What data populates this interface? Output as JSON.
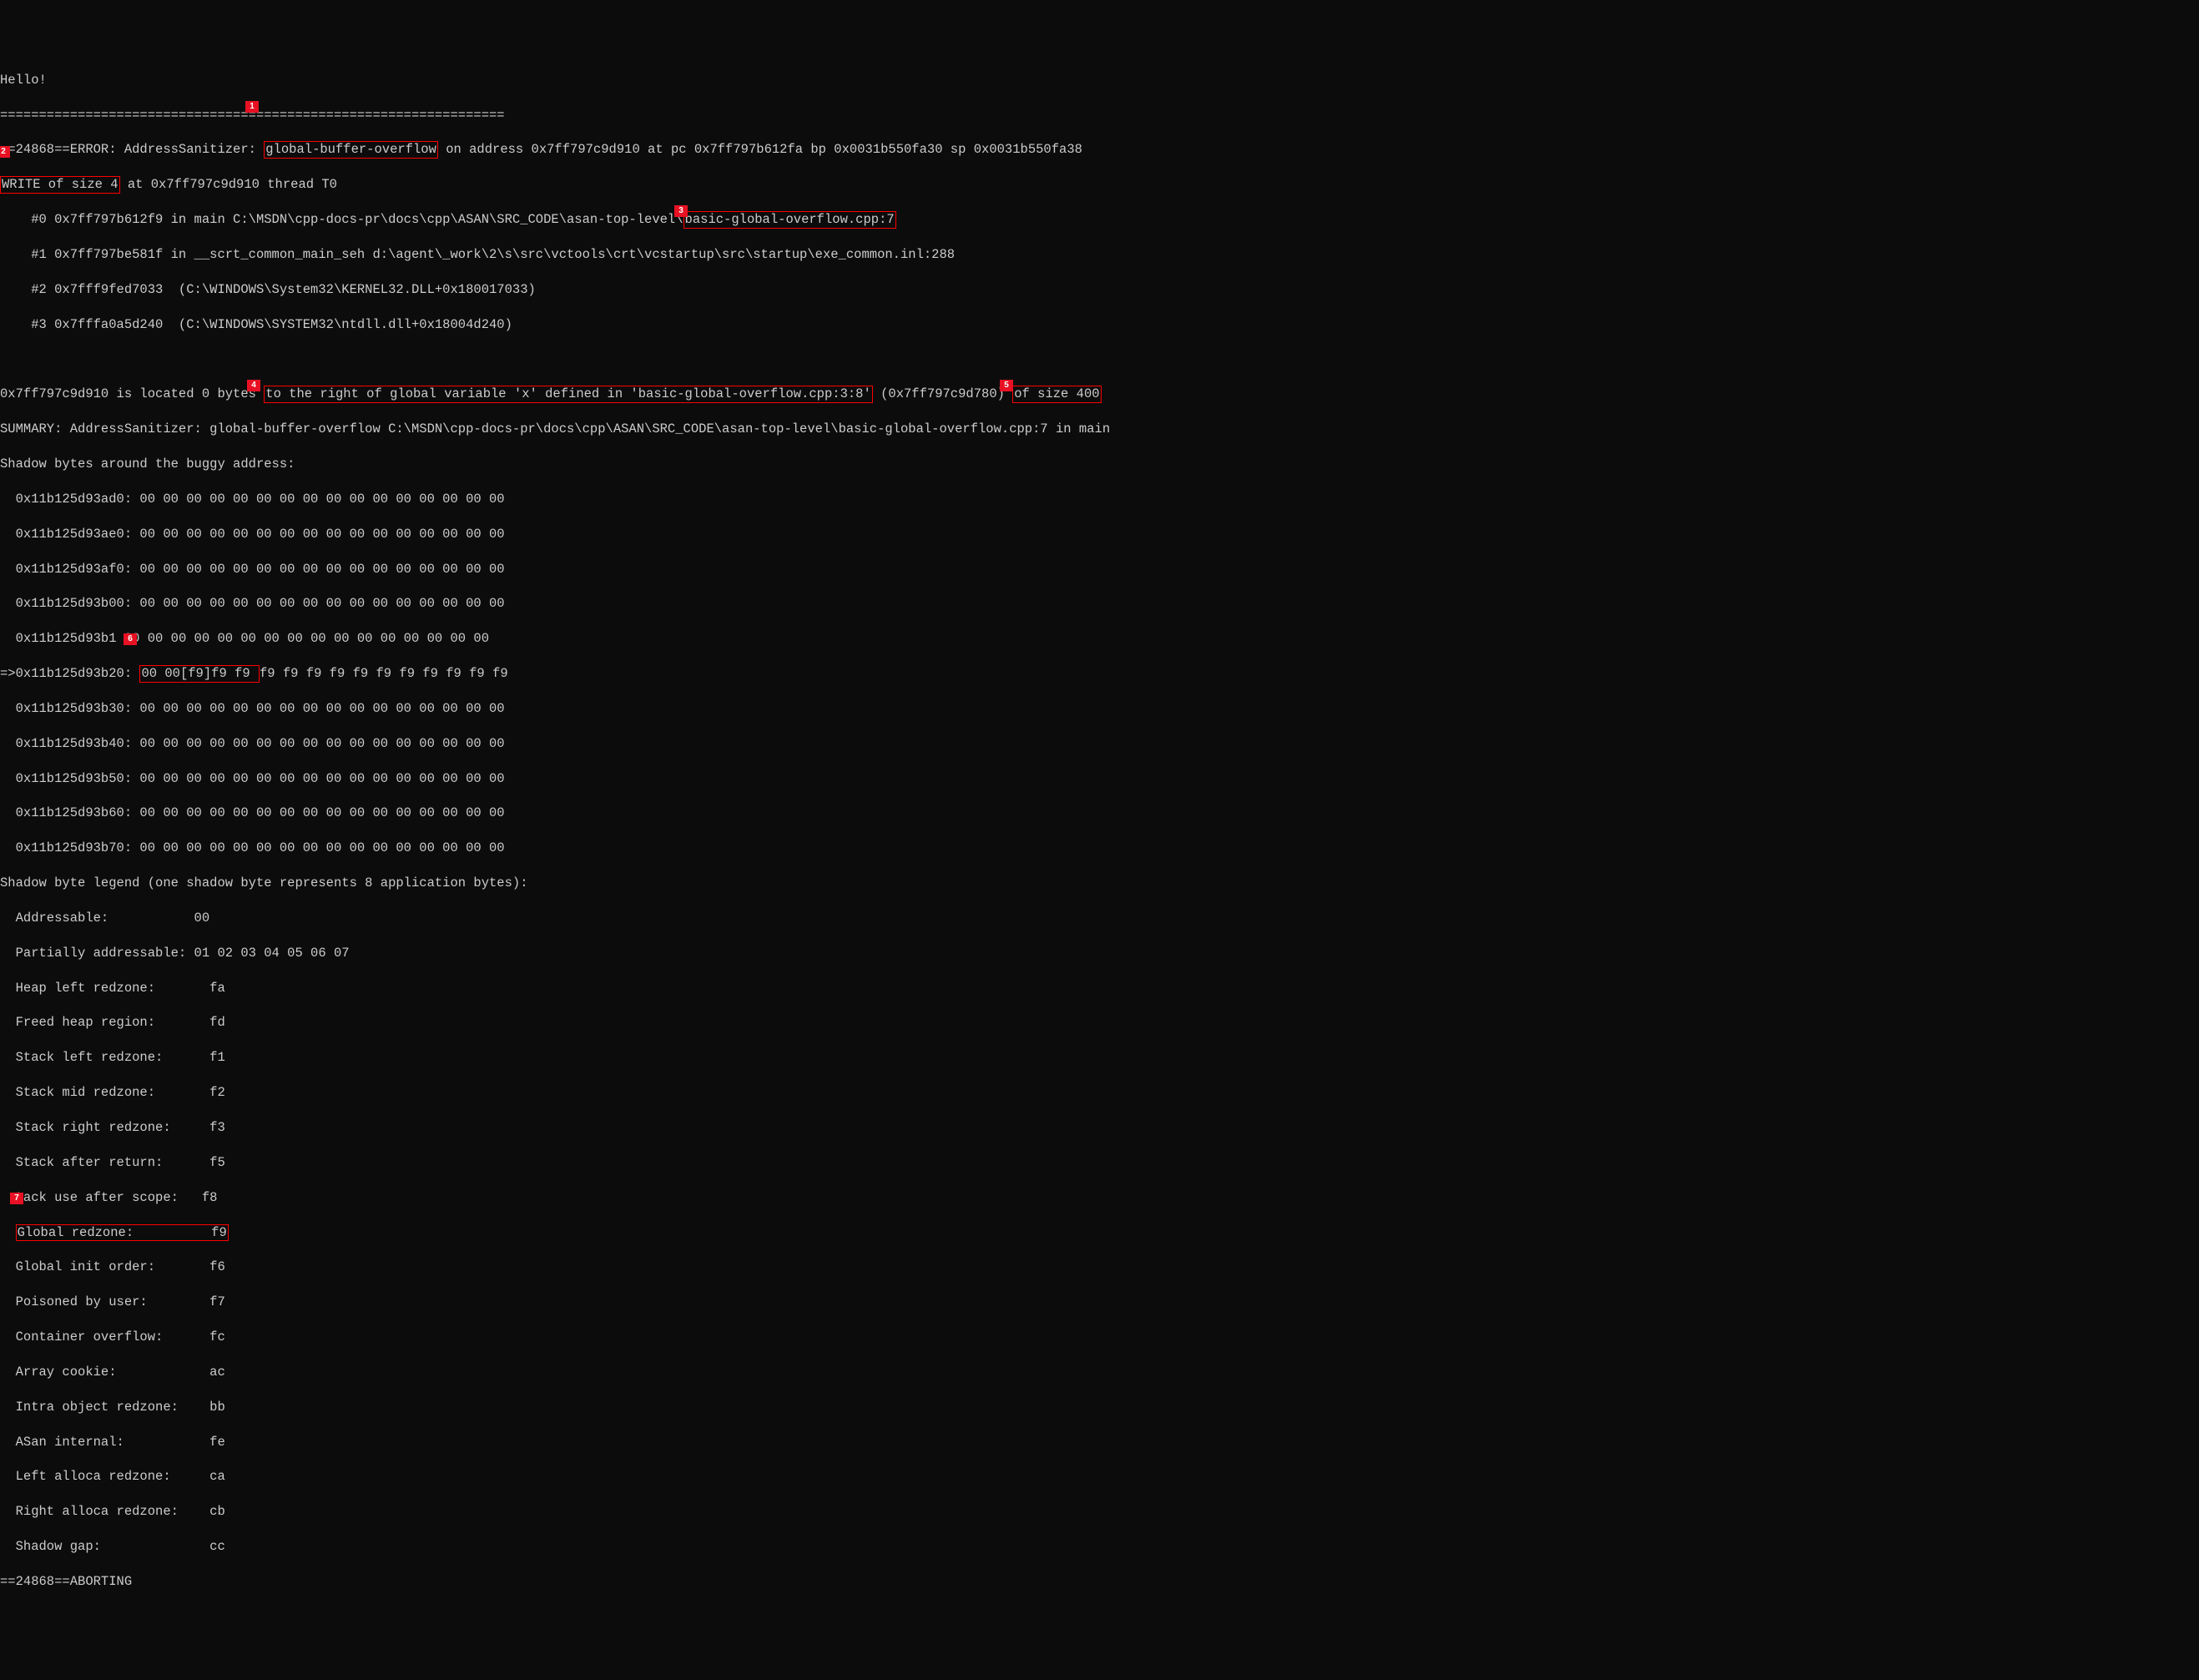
{
  "hello": "Hello!",
  "sep": "=================================================================",
  "err_a": "==24868==ERROR: AddressSanitizer: ",
  "err_type": "global-buffer-overflow",
  "err_b": " on address 0x7ff797c9d910 at pc 0x7ff797b612fa bp 0x0031b550fa30 sp 0x0031b550fa38",
  "write_a": "WRITE of size 4",
  "write_b": " at 0x7ff797c9d910 thread T0",
  "stack": {
    "f0a": "    #0 0x7ff797b612f9 in main C:\\MSDN\\cpp-docs-pr\\docs\\cpp\\ASAN\\SRC_CODE\\asan-top-level\\",
    "f0b": "basic-global-overflow.cpp:7",
    "f1": "    #1 0x7ff797be581f in __scrt_common_main_seh d:\\agent\\_work\\2\\s\\src\\vctools\\crt\\vcstartup\\src\\startup\\exe_common.inl:288",
    "f2": "    #2 0x7fff9fed7033  (C:\\WINDOWS\\System32\\KERNEL32.DLL+0x180017033)",
    "f3": "    #3 0x7fffa0a5d240  (C:\\WINDOWS\\SYSTEM32\\ntdll.dll+0x18004d240)"
  },
  "loc_a": "0x7ff797c9d910 is located 0 bytes ",
  "loc_b": "to the right of global variable 'x' defined in 'basic-global-overflow.cpp:3:8'",
  "loc_c": " (0x7ff797c9d780) ",
  "loc_d": "of size 400",
  "summary": "SUMMARY: AddressSanitizer: global-buffer-overflow C:\\MSDN\\cpp-docs-pr\\docs\\cpp\\ASAN\\SRC_CODE\\asan-top-level\\basic-global-overflow.cpp:7 in main",
  "shadow_hdr": "Shadow bytes around the buggy address:",
  "shadow": {
    "r0": "  0x11b125d93ad0: 00 00 00 00 00 00 00 00 00 00 00 00 00 00 00 00",
    "r1": "  0x11b125d93ae0: 00 00 00 00 00 00 00 00 00 00 00 00 00 00 00 00",
    "r2": "  0x11b125d93af0: 00 00 00 00 00 00 00 00 00 00 00 00 00 00 00 00",
    "r3": "  0x11b125d93b00: 00 00 00 00 00 00 00 00 00 00 00 00 00 00 00 00",
    "r4a": "  0x11b125d93b1",
    "r4b": " 00 00 00 00 00 00 00 00 00 00 00 00 00 00 00 00",
    "r5a": "=>0x11b125d93b20: ",
    "r5b": "00 00[f9]f9 f9 ",
    "r5c": "f9 f9 f9 f9 f9 f9 f9 f9 f9 f9 f9",
    "r6": "  0x11b125d93b30: 00 00 00 00 00 00 00 00 00 00 00 00 00 00 00 00",
    "r7": "  0x11b125d93b40: 00 00 00 00 00 00 00 00 00 00 00 00 00 00 00 00",
    "r8": "  0x11b125d93b50: 00 00 00 00 00 00 00 00 00 00 00 00 00 00 00 00",
    "r9": "  0x11b125d93b60: 00 00 00 00 00 00 00 00 00 00 00 00 00 00 00 00",
    "r10": "  0x11b125d93b70: 00 00 00 00 00 00 00 00 00 00 00 00 00 00 00 00"
  },
  "legend_hdr": "Shadow byte legend (one shadow byte represents 8 application bytes):",
  "legend": {
    "addr": "  Addressable:           00",
    "part": "  Partially addressable: 01 02 03 04 05 06 07",
    "heapL": "  Heap left redzone:       fa",
    "freed": "  Freed heap region:       fd",
    "stackL": "  Stack left redzone:      f1",
    "stackM": "  Stack mid redzone:       f2",
    "stackR": "  Stack right redzone:     f3",
    "stackAfter": "  Stack after return:      f5",
    "stackScope_a": "  ",
    "stackScope_b": "tack use after scope:   f8",
    "globalR_a": "  ",
    "globalR_b": "Global redzone:          f9",
    "globalI": "  Global init order:       f6",
    "poison": "  Poisoned by user:        f7",
    "cont": "  Container overflow:      fc",
    "cookie": "  Array cookie:            ac",
    "intra": "  Intra object redzone:    bb",
    "asan": "  ASan internal:           fe",
    "leftA": "  Left alloca redzone:     ca",
    "rightA": "  Right alloca redzone:    cb",
    "gap": "  Shadow gap:              cc"
  },
  "abort": "==24868==ABORTING",
  "callouts": {
    "c1": "1",
    "c2": "2",
    "c3": "3",
    "c4": "4",
    "c5": "5",
    "c6": "6",
    "c7": "7"
  }
}
